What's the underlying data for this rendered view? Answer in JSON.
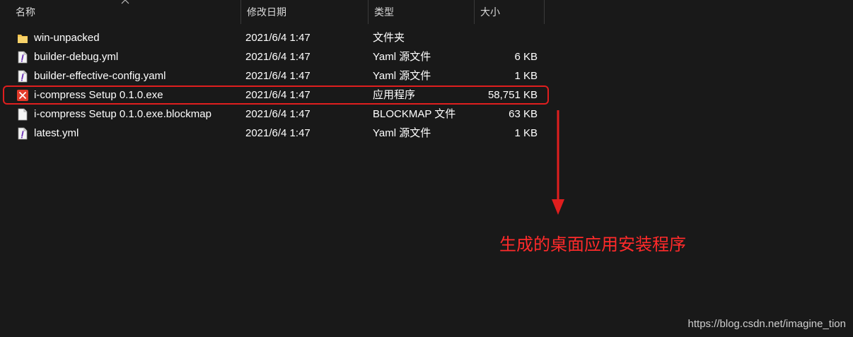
{
  "columns": {
    "name": "名称",
    "date": "修改日期",
    "type": "类型",
    "size": "大小"
  },
  "files": [
    {
      "icon": "folder-icon",
      "name": "win-unpacked",
      "date": "2021/6/4 1:47",
      "type": "文件夹",
      "size": ""
    },
    {
      "icon": "yaml-file-icon",
      "name": "builder-debug.yml",
      "date": "2021/6/4 1:47",
      "type": "Yaml 源文件",
      "size": "6 KB"
    },
    {
      "icon": "yaml-file-icon",
      "name": "builder-effective-config.yaml",
      "date": "2021/6/4 1:47",
      "type": "Yaml 源文件",
      "size": "1 KB"
    },
    {
      "icon": "app-icon",
      "name": "i-compress Setup 0.1.0.exe",
      "date": "2021/6/4 1:47",
      "type": "应用程序",
      "size": "58,751 KB"
    },
    {
      "icon": "blank-file-icon",
      "name": "i-compress Setup 0.1.0.exe.blockmap",
      "date": "2021/6/4 1:47",
      "type": "BLOCKMAP 文件",
      "size": "63 KB"
    },
    {
      "icon": "yaml-file-icon",
      "name": "latest.yml",
      "date": "2021/6/4 1:47",
      "type": "Yaml 源文件",
      "size": "1 KB"
    }
  ],
  "annotation": "生成的桌面应用安装程序",
  "watermark": "https://blog.csdn.net/imagine_tion",
  "colors": {
    "background": "#191919",
    "highlight": "#e01e1e",
    "annotation": "#ff2a2a",
    "folder": "#f3c14b"
  }
}
